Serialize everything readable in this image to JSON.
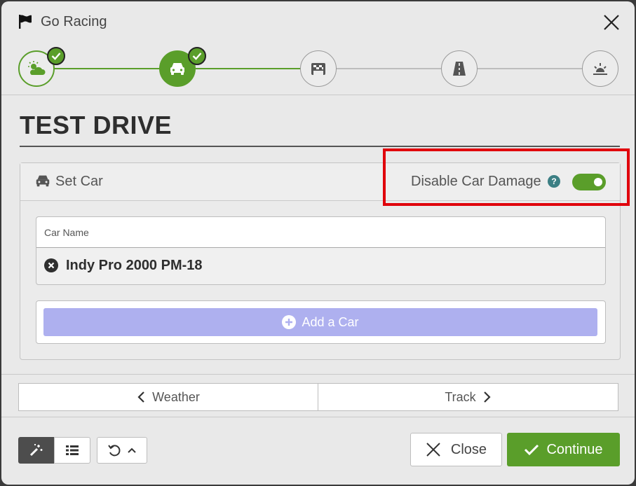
{
  "window": {
    "title": "Go Racing"
  },
  "stepper": {
    "steps": [
      {
        "name": "weather",
        "state": "done"
      },
      {
        "name": "car",
        "state": "active"
      },
      {
        "name": "session",
        "state": "pending"
      },
      {
        "name": "track",
        "state": "pending"
      },
      {
        "name": "review",
        "state": "pending"
      }
    ]
  },
  "page": {
    "heading": "TEST DRIVE"
  },
  "car_panel": {
    "header_label": "Set Car",
    "damage_label": "Disable Car Damage",
    "help": "?",
    "damage_toggle_on": true,
    "table_header": "Car Name",
    "cars": [
      "Indy Pro 2000 PM-18"
    ],
    "add_label": "Add a Car"
  },
  "nav": {
    "prev_label": "Weather",
    "next_label": "Track"
  },
  "footer": {
    "close_label": "Close",
    "continue_label": "Continue"
  },
  "colors": {
    "accent": "#5a9e2a",
    "add_button": "#aeb0ef",
    "highlight": "#e0000b",
    "help": "#3c7f84"
  }
}
